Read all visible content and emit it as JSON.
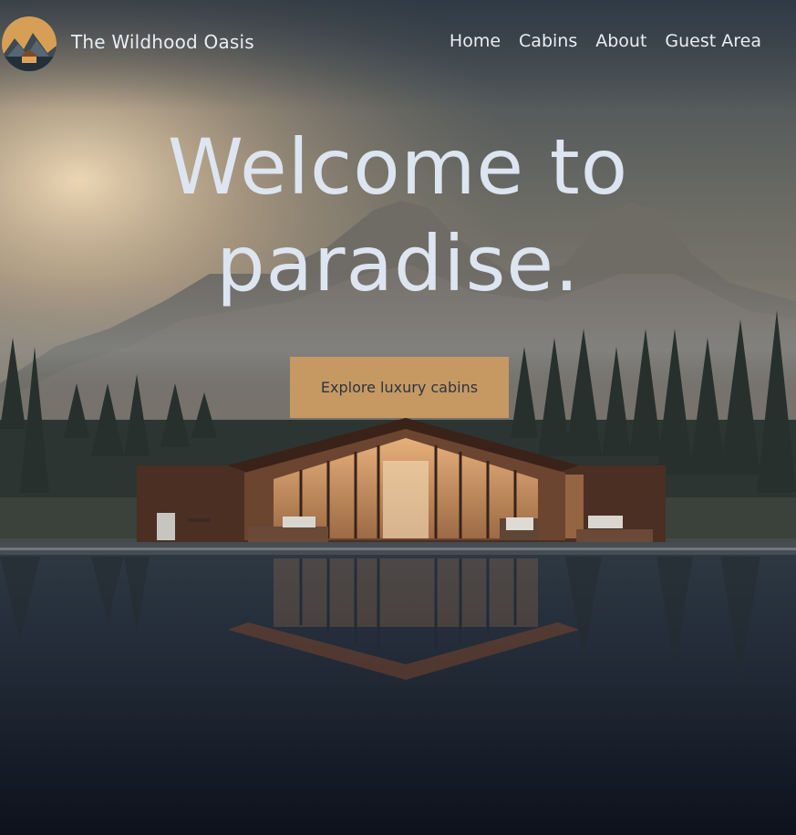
{
  "brand": {
    "name": "The Wildhood Oasis",
    "logo_icon": "cabin-mountain-logo-icon"
  },
  "nav": {
    "items": [
      "Home",
      "Cabins",
      "About",
      "Guest Area"
    ]
  },
  "hero": {
    "title_line1": "Welcome to",
    "title_line2": "paradise.",
    "cta_label": "Explore luxury cabins"
  },
  "colors": {
    "accent": "#c69963",
    "text_light": "#e8edf5",
    "cta_text": "#2d3441",
    "background_dark": "#141a24"
  }
}
